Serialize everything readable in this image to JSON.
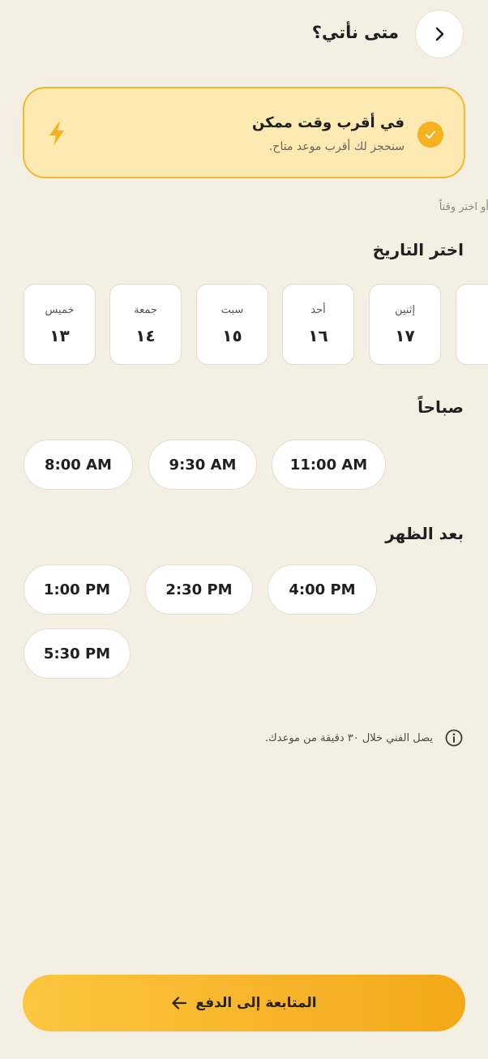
{
  "header": {
    "title": "متى نأتي؟",
    "back_icon": "chevron-right-icon"
  },
  "asap": {
    "title": "في أقرب وقت ممكن",
    "subtitle": "سنحجز لك أقرب موعد متاح.",
    "selected": true,
    "icon": "bolt-icon",
    "accent": "#f5b11f",
    "card_bg": "#fde9b2"
  },
  "or_label": "أو اختر وقتاً",
  "date_section": {
    "title": "اختر التاريخ",
    "dates": [
      {
        "day": "إثنين",
        "num": "١٧"
      },
      {
        "day": "أحد",
        "num": "١٦"
      },
      {
        "day": "سبت",
        "num": "١٥"
      },
      {
        "day": "جمعة",
        "num": "١٤"
      },
      {
        "day": "خميس",
        "num": "١٣"
      }
    ]
  },
  "morning": {
    "title": "صباحاً",
    "slots": [
      "11:00 AM",
      "9:30 AM",
      "8:00 AM"
    ]
  },
  "afternoon": {
    "title": "بعد الظهر",
    "slots": [
      "4:00 PM",
      "2:30 PM",
      "1:00 PM",
      "5:30 PM"
    ]
  },
  "info": {
    "icon": "info-icon",
    "text": "يصل الفني خلال ٣٠ دقيقة من موعدك."
  },
  "cta": {
    "label": "المتابعة إلى الدفع",
    "icon": "arrow-left-icon"
  },
  "colors": {
    "background": "#f4efe3",
    "brand_yellow": "#f7b32a"
  }
}
